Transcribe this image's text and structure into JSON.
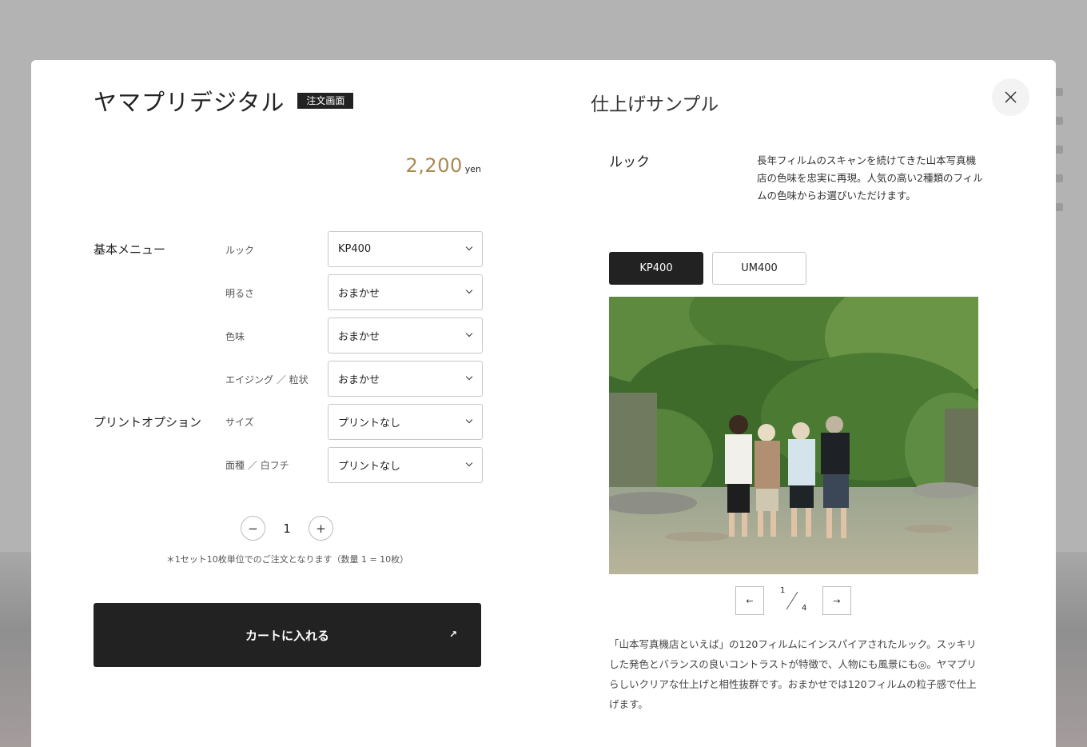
{
  "order": {
    "title": "ヤマプリデジタル",
    "badge": "注文画面",
    "price": "2,200",
    "price_unit": "yen",
    "sections": {
      "basic": "基本メニュー",
      "print": "プリントオプション"
    },
    "options": [
      {
        "label": "ルック",
        "value": "KP400"
      },
      {
        "label": "明るさ",
        "value": "おまかせ"
      },
      {
        "label": "色味",
        "value": "おまかせ"
      },
      {
        "label": "エイジング ／ 粒状",
        "value": "おまかせ"
      },
      {
        "label": "サイズ",
        "value": "プリントなし"
      },
      {
        "label": "面種 ／ 白フチ",
        "value": "プリントなし"
      }
    ],
    "quantity": {
      "minus": "−",
      "plus": "+",
      "value": "1",
      "note": "＊1セット10枚単位でのご注文となります（数量 1 = 10枚）"
    },
    "cart_label": "カートに入れる",
    "cart_arrow": "↗"
  },
  "sample": {
    "title": "仕上げサンプル",
    "look_title": "ルック",
    "look_desc": "長年フィルムのスキャンを続けてきた山本写真機店の色味を忠実に再現。人気の高い2種類のフィルムの色味からお選びいただけます。",
    "tabs": [
      {
        "label": "KP400"
      },
      {
        "label": "UM400"
      }
    ],
    "pager": {
      "prev": "←",
      "next": "→",
      "current": "1",
      "total": "4"
    },
    "description": "「山本写真機店といえば」の120フィルムにインスパイアされたルック。スッキリした発色とバランスの良いコントラストが特徴で、人物にも風景にも◎。ヤマプリらしいクリアな仕上げと相性抜群です。おまかせでは120フィルムの粒子感で仕上げます。"
  },
  "colors": {
    "accent": "#a8894f",
    "dark": "#222222",
    "overlay": "#b3b3b3"
  },
  "icons": {
    "close": "close-icon",
    "chevron": "chevron-down-icon"
  }
}
